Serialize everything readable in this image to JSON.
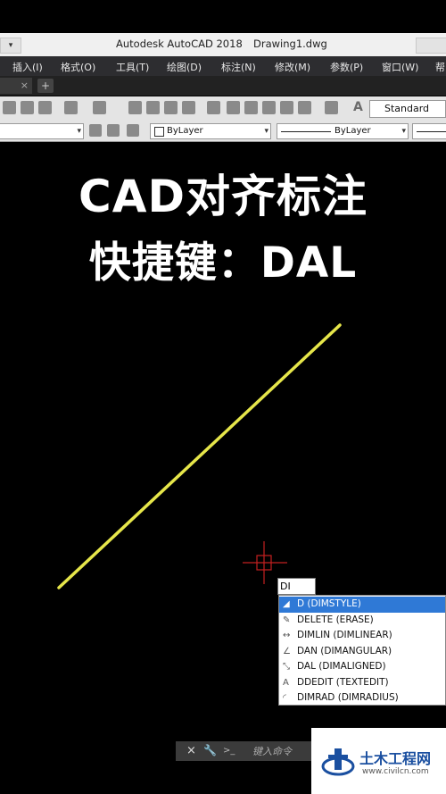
{
  "window": {
    "app_title": "Autodesk AutoCAD 2018",
    "file_title": "Drawing1.dwg"
  },
  "menu": [
    "插入(I)",
    "格式(O)",
    "工具(T)",
    "绘图(D)",
    "标注(N)",
    "修改(M)",
    "参数(P)",
    "窗口(W)",
    "帮"
  ],
  "tabs": {
    "close_glyph": "×",
    "new_glyph": "+"
  },
  "toolbar": {
    "text_style": "Standard",
    "text_style_icon": "A"
  },
  "properties": {
    "color": "ByLayer",
    "linetype": "ByLayer"
  },
  "overlay": {
    "line1": "CAD对齐标注",
    "line2": "快捷键：DAL"
  },
  "drawing": {
    "line_color": "#e6e64a",
    "cursor_color": "#c42020"
  },
  "command": {
    "input_value": "DI",
    "suggestions": [
      {
        "label": "D (DIMSTYLE)",
        "icon": "dimstyle-icon",
        "glyph": "◢",
        "selected": true
      },
      {
        "label": "DELETE (ERASE)",
        "icon": "erase-icon",
        "glyph": "✎",
        "selected": false
      },
      {
        "label": "DIMLIN (DIMLINEAR)",
        "icon": "dimlinear-icon",
        "glyph": "↔",
        "selected": false
      },
      {
        "label": "DAN (DIMANGULAR)",
        "icon": "dimangular-icon",
        "glyph": "∠",
        "selected": false
      },
      {
        "label": "DAL (DIMALIGNED)",
        "icon": "dimaligned-icon",
        "glyph": "⤡",
        "selected": false
      },
      {
        "label": "DDEDIT (TEXTEDIT)",
        "icon": "textedit-icon",
        "glyph": "A",
        "selected": false
      },
      {
        "label": "DIMRAD (DIMRADIUS)",
        "icon": "dimradius-icon",
        "glyph": "◜",
        "selected": false
      }
    ],
    "close_glyph": "×",
    "prompt_glyph": ">_",
    "placeholder": "键入命令"
  },
  "watermark": {
    "brand": "土木工程网",
    "url": "www.civilcn.com"
  }
}
